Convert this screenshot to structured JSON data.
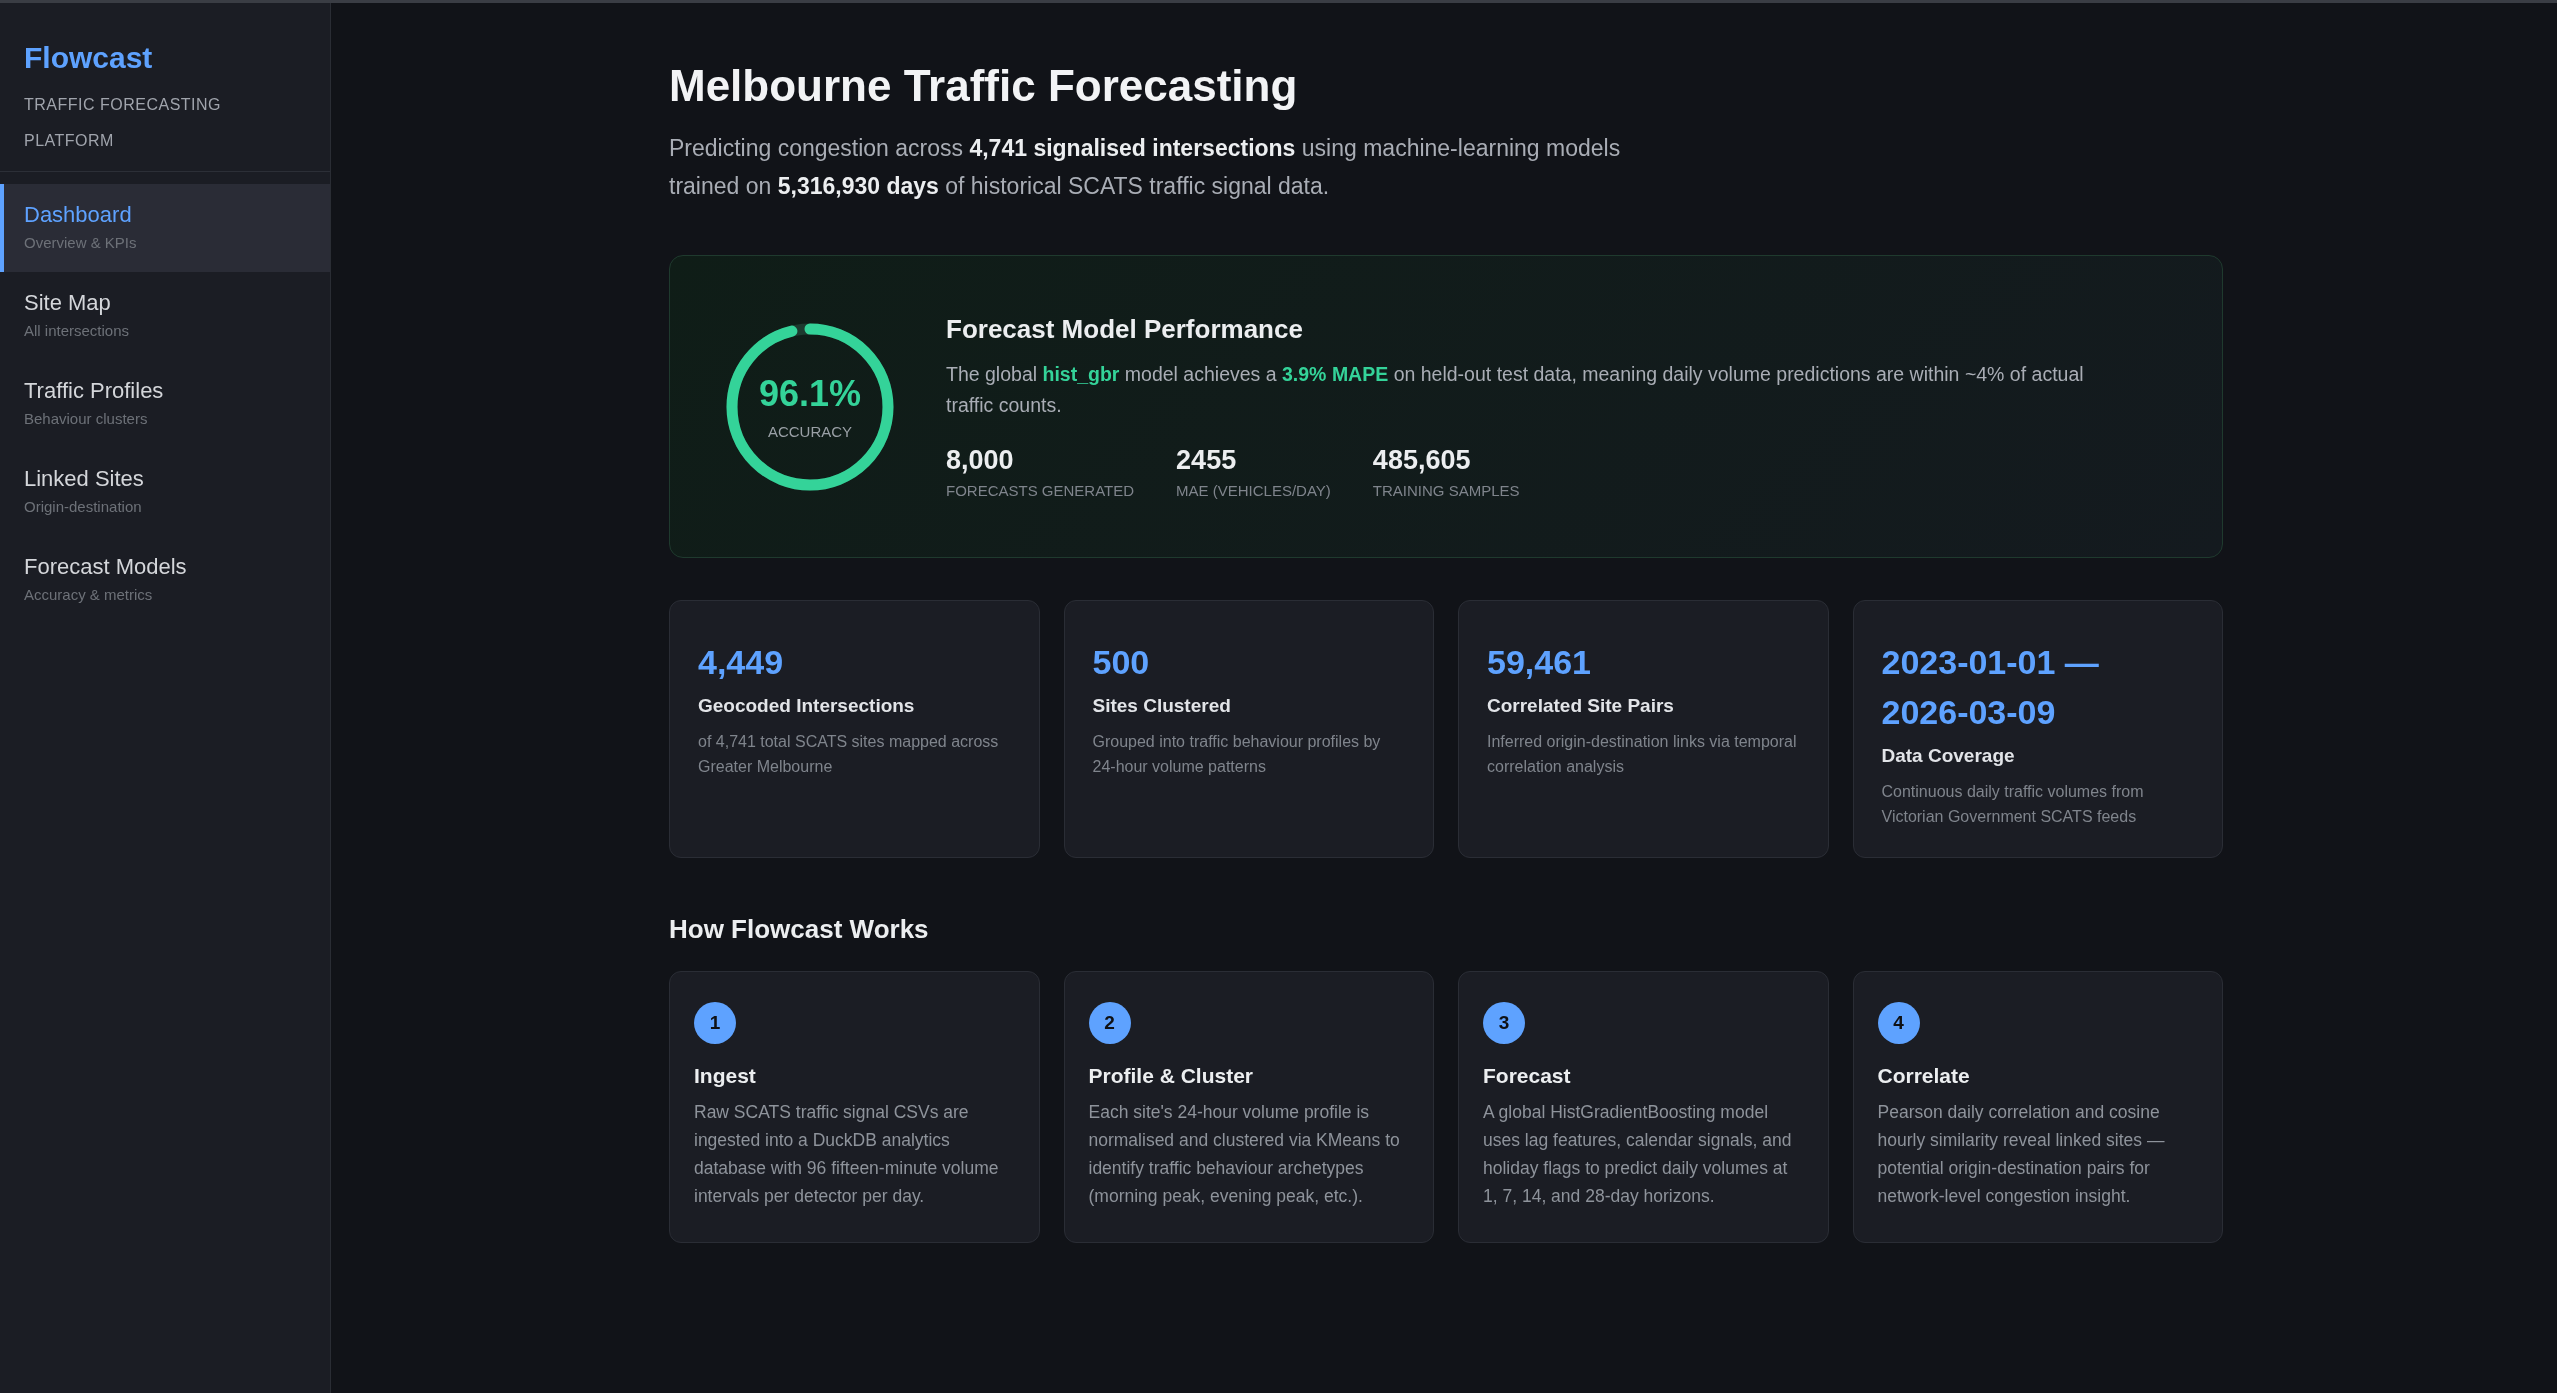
{
  "sidebar": {
    "brand": "Flowcast",
    "tagline": "TRAFFIC FORECASTING PLATFORM",
    "items": [
      {
        "label": "Dashboard",
        "sub": "Overview & KPIs",
        "selected": true
      },
      {
        "label": "Site Map",
        "sub": "All intersections",
        "selected": false
      },
      {
        "label": "Traffic Profiles",
        "sub": "Behaviour clusters",
        "selected": false
      },
      {
        "label": "Linked Sites",
        "sub": "Origin-destination",
        "selected": false
      },
      {
        "label": "Forecast Models",
        "sub": "Accuracy & metrics",
        "selected": false
      }
    ]
  },
  "header": {
    "title": "Melbourne Traffic Forecasting",
    "subtitle": "Predicting congestion across **4,741 signalised intersections** using machine-learning models trained on **5,316,930 days** of historical SCATS traffic signal data."
  },
  "performance": {
    "gauge": {
      "value": "96.1%",
      "label": "ACCURACY",
      "level": 0.961
    },
    "title": "Forecast Model Performance",
    "description": "The global **hist_gbr** model achieves a **3.9% MAPE** on held-out test data, meaning daily volume predictions are within ~4% of actual traffic counts.",
    "stats": [
      {
        "value": "8,000",
        "label": "FORECASTS GENERATED"
      },
      {
        "value": "2455",
        "label": "MAE (VEHICLES/DAY)"
      },
      {
        "value": "485,605",
        "label": "TRAINING SAMPLES"
      }
    ]
  },
  "kpis": [
    {
      "value": "4,449",
      "title": "Geocoded Intersections",
      "text": "of 4,741 total SCATS sites mapped across Greater Melbourne"
    },
    {
      "value": "500",
      "title": "Sites Clustered",
      "text": "Grouped into traffic behaviour profiles by 24-hour volume patterns"
    },
    {
      "value": "59,461",
      "title": "Correlated Site Pairs",
      "text": "Inferred origin-destination links via temporal correlation analysis"
    },
    {
      "value": "2023-01-01 — 2026-03-09",
      "title": "Data Coverage",
      "text": "Continuous daily traffic volumes from Victorian Government SCATS feeds"
    }
  ],
  "how_it_works": {
    "title": "How Flowcast Works",
    "steps": [
      {
        "number": "1",
        "title": "Ingest",
        "text": "Raw SCATS traffic signal CSVs are ingested into a DuckDB analytics database with 96 fifteen-minute volume intervals per detector per day."
      },
      {
        "number": "2",
        "title": "Profile & Cluster",
        "text": "Each site's 24-hour volume profile is normalised and clustered via KMeans to identify traffic behaviour archetypes (morning peak, evening peak, etc.)."
      },
      {
        "number": "3",
        "title": "Forecast",
        "text": "A global HistGradientBoosting model uses lag features, calendar signals, and holiday flags to predict daily volumes at 1, 7, 14, and 28-day horizons."
      },
      {
        "number": "4",
        "title": "Correlate",
        "text": "Pearson daily correlation and cosine hourly similarity reveal linked sites — potential origin-destination pairs for network-level congestion insight."
      }
    ]
  }
}
